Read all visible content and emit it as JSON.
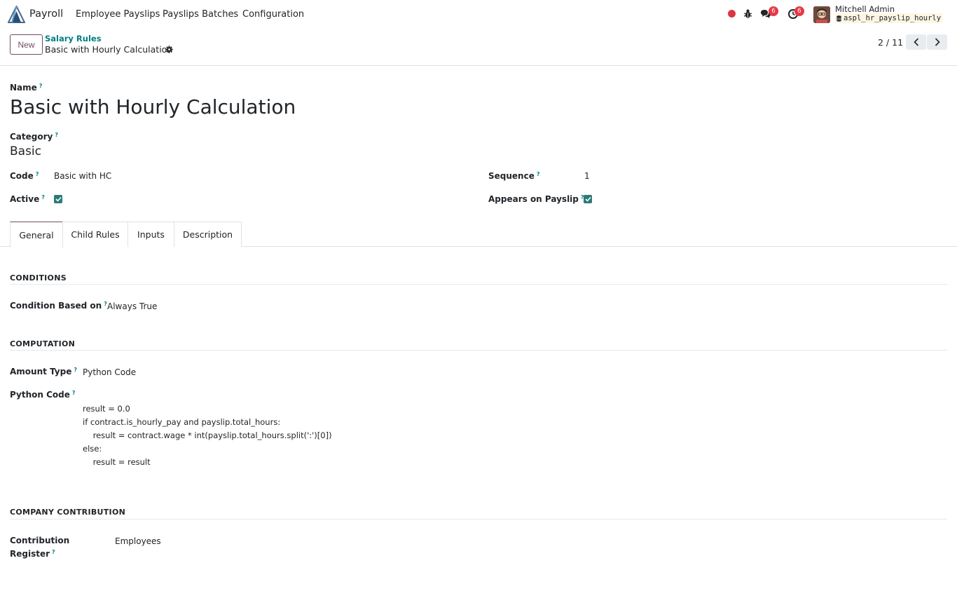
{
  "navbar": {
    "app_name": "Payroll",
    "menu": [
      "Employee Payslips",
      "Payslips Batches",
      "Configuration"
    ],
    "messages_badge": "6",
    "activities_badge": "6",
    "user_name": "Mitchell Admin",
    "database": "aspl_hr_payslip_hourly"
  },
  "control_panel": {
    "new_label": "New",
    "breadcrumb_parent": "Salary Rules",
    "breadcrumb_current": "Basic with Hourly Calculation",
    "pager": "2 / 11"
  },
  "form": {
    "name_label": "Name",
    "name_value": "Basic with Hourly Calculation",
    "category_label": "Category",
    "category_value": "Basic",
    "code_label": "Code",
    "code_value": "Basic with HC",
    "sequence_label": "Sequence",
    "sequence_value": "1",
    "active_label": "Active",
    "active_checked": true,
    "appears_label": "Appears on Payslip",
    "appears_checked": true,
    "help_mark": "?"
  },
  "tabs": [
    "General",
    "Child Rules",
    "Inputs",
    "Description"
  ],
  "general": {
    "conditions_title": "CONDITIONS",
    "condition_label": "Condition Based on",
    "condition_value": "Always True",
    "computation_title": "COMPUTATION",
    "amount_type_label": "Amount Type",
    "amount_type_value": "Python Code",
    "python_code_label": "Python Code",
    "python_code_lines": [
      "result = 0.0",
      "if contract.is_hourly_pay and payslip.total_hours:",
      "    result = contract.wage * int(payslip.total_hours.split(':')[0])",
      "else:",
      "    result = result"
    ],
    "company_title": "COMPANY CONTRIBUTION",
    "contribution_label_1": "Contribution",
    "contribution_label_2": "Register",
    "contribution_value": "Employees"
  },
  "colors": {
    "brand": "#714b67",
    "link": "#017e84",
    "checkbox": "#2b7a78",
    "badge": "#e63946"
  }
}
